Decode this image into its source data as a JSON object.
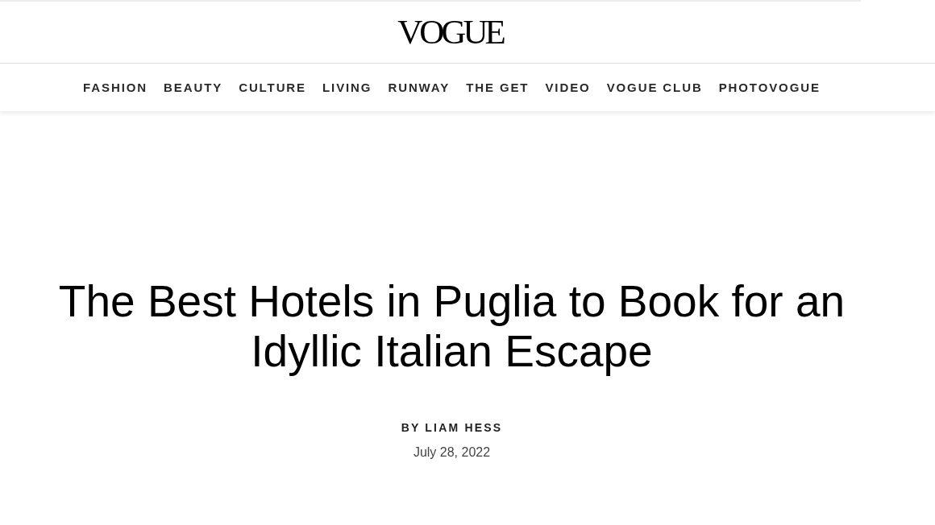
{
  "header": {
    "logo": "VOGUE"
  },
  "nav": {
    "items": [
      {
        "label": "FASHION"
      },
      {
        "label": "BEAUTY"
      },
      {
        "label": "CULTURE"
      },
      {
        "label": "LIVING"
      },
      {
        "label": "RUNWAY"
      },
      {
        "label": "THE GET"
      },
      {
        "label": "VIDEO"
      },
      {
        "label": "VOGUE CLUB"
      },
      {
        "label": "PHOTOVOGUE"
      }
    ]
  },
  "article": {
    "headline": "The Best Hotels in Puglia to Book for an Idyllic Italian Escape",
    "byline": "BY LIAM HESS",
    "date": "July 28, 2022"
  }
}
